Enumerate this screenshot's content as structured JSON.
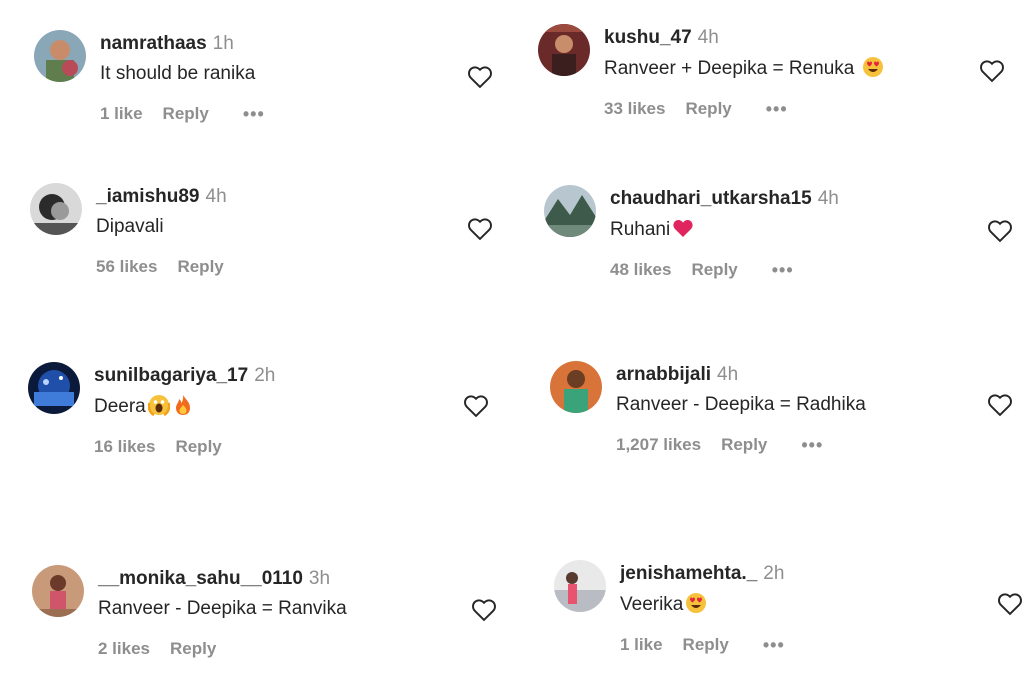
{
  "comments": [
    {
      "username": "namrathaas",
      "time": "1h",
      "text": "It should be ranika",
      "likes": "1 like",
      "reply": "Reply",
      "more": "•••"
    },
    {
      "username": "_iamishu89",
      "time": "4h",
      "text": "Dipavali",
      "likes": "56 likes",
      "reply": "Reply",
      "more": ""
    },
    {
      "username": "sunilbagariya_17",
      "time": "2h",
      "text": "Deera",
      "likes": "16 likes",
      "reply": "Reply",
      "more": ""
    },
    {
      "username": "__monika_sahu__0110",
      "time": "3h",
      "text": "Ranveer - Deepika = Ranvika",
      "likes": "2 likes",
      "reply": "Reply",
      "more": ""
    },
    {
      "username": "kushu_47",
      "time": "4h",
      "text": "Ranveer + Deepika = Renuka",
      "likes": "33 likes",
      "reply": "Reply",
      "more": "•••"
    },
    {
      "username": "chaudhari_utkarsha15",
      "time": "4h",
      "text": "Ruhani",
      "likes": "48 likes",
      "reply": "Reply",
      "more": "•••"
    },
    {
      "username": "arnabbijali",
      "time": "4h",
      "text": "Ranveer - Deepika = Radhika",
      "likes": "1,207 likes",
      "reply": "Reply",
      "more": "•••"
    },
    {
      "username": "jenishamehta._",
      "time": "2h",
      "text": "Veerika",
      "likes": "1 like",
      "reply": "Reply",
      "more": "•••"
    }
  ],
  "icons": {
    "like": "heart-outline-icon",
    "heart_eyes": "heart-eyes-emoji",
    "red_heart": "red-heart-emoji",
    "flame": "fire-emoji",
    "fear": "screaming-face-emoji"
  },
  "colors": {
    "text": "#262626",
    "secondary": "#8e8e8e",
    "heart_red": "#e0245e"
  }
}
